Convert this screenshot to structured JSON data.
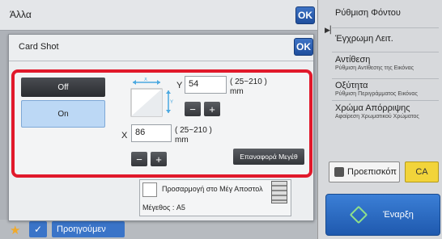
{
  "header": {
    "title": "Άλλα",
    "ok_label": "OK"
  },
  "right_panel": {
    "items": [
      {
        "label": "Ρύθμιση Φόντου",
        "sub": ""
      },
      {
        "label": "Έγχρωμη Λειτ.",
        "sub": ""
      },
      {
        "label": "Αντίθεση",
        "sub": "Ρύθμιση Αντίθεσης της Εικόνας"
      },
      {
        "label": "Οξύτητα",
        "sub": "Ρύθμιση Περιγράμματος Εικόνας"
      },
      {
        "label": "Χρώμα Απόρριψης",
        "sub": "Αφαίρεση Χρωματικού Χρώματος"
      }
    ],
    "preview_label": "Προεπισκόπ",
    "ca_label": "CA",
    "start_label": "Έναρξη"
  },
  "bottom": {
    "back_label": "Προηγούμεν"
  },
  "dialog": {
    "title": "Card Shot",
    "ok_label": "OK",
    "off_label": "Off",
    "on_label": "On",
    "y_label": "Y",
    "y_value": "54",
    "y_range": "( 25~210 )",
    "y_unit": "mm",
    "x_label": "X",
    "x_value": "86",
    "x_range": "( 25~210 )",
    "x_unit": "mm",
    "minus": "−",
    "plus": "+",
    "reset_label": "Επαναφορά Μεγέθ",
    "fit_label": "Προσαρμογή στο Μέγ Αποστολ",
    "size_text": "Μέγεθος  :  A5"
  }
}
